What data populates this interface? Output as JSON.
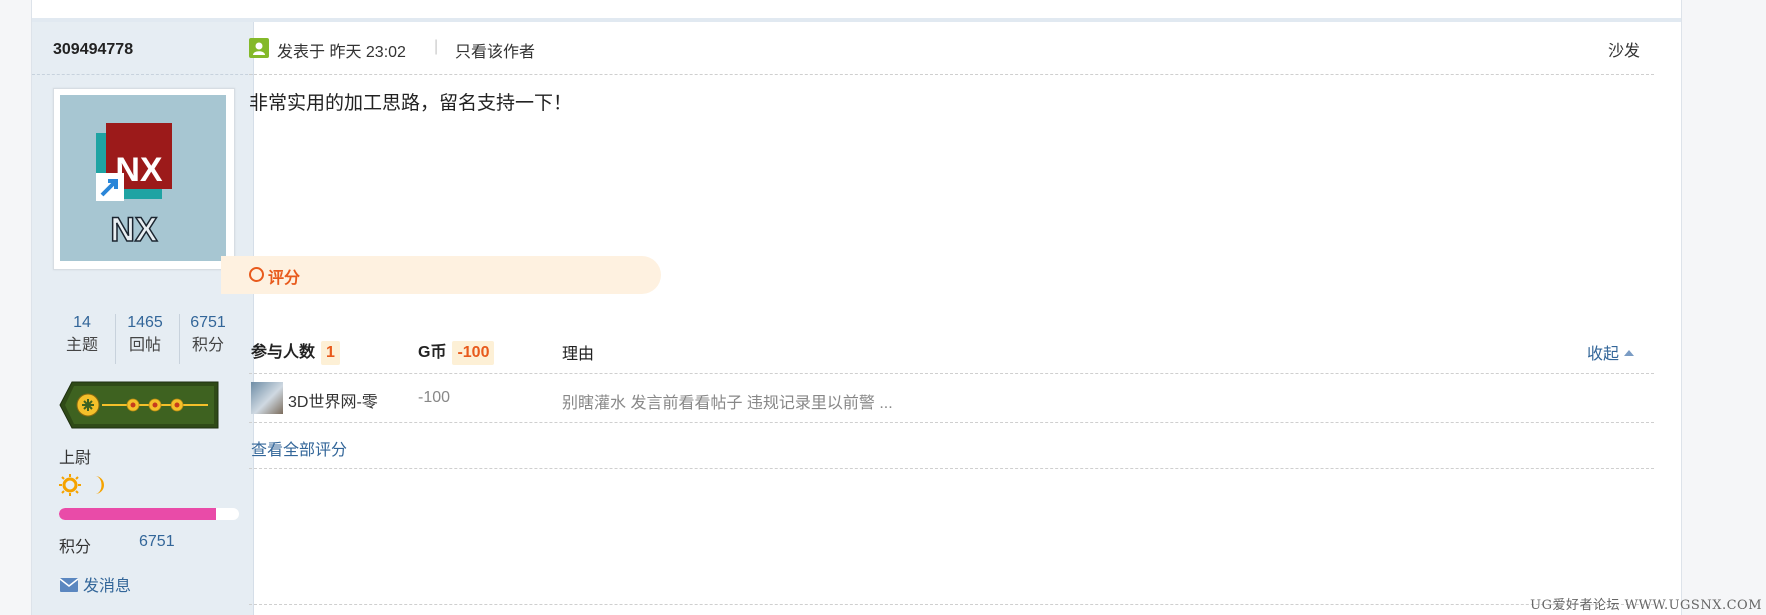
{
  "author": {
    "username": "309494778",
    "avatar_text": "NX",
    "stats": [
      {
        "value": "14",
        "label": "主题"
      },
      {
        "value": "1465",
        "label": "回帖"
      },
      {
        "value": "6751",
        "label": "积分"
      }
    ],
    "rank_title": "上尉",
    "level_progress": 0.87,
    "score_label": "积分",
    "score_value": "6751",
    "send_message": "发消息"
  },
  "post": {
    "time": "发表于 昨天 23:02",
    "divider": "|",
    "only_author": "只看该作者",
    "floor": "沙发",
    "content": "非常实用的加工思路，留名支持一下！"
  },
  "rating": {
    "banner_label": "评分",
    "participants_label": "参与人数",
    "participants_count": "1",
    "coin_label": "G币",
    "coin_total": "-100",
    "reason_label": "理由",
    "collapse": "收起",
    "rows": [
      {
        "user": "3D世界网-零",
        "coin": "-100",
        "reason": "别瞎灌水 发言前看看帖子 违规记录里以前警 ..."
      }
    ],
    "view_all": "查看全部评分"
  },
  "watermark": "UG爱好者论坛 WWW.UGSNX.COM",
  "colors": {
    "link": "#336699",
    "accent": "#e85a1c",
    "progress": "#e94ba8",
    "sidebar": "#e6edf3"
  }
}
